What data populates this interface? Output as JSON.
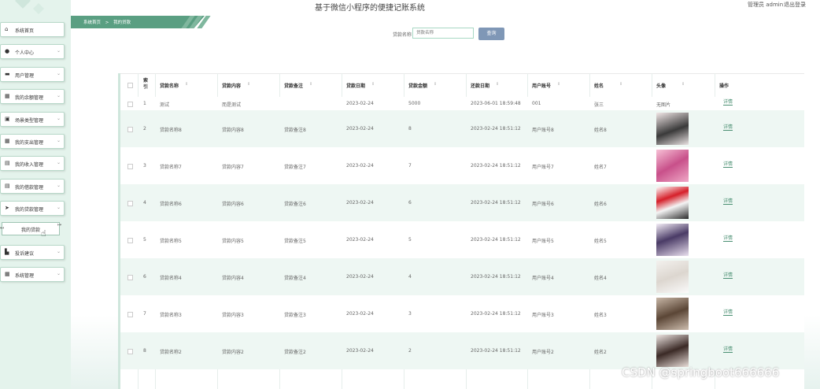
{
  "header": {
    "title": "基于微信小程序的便捷记账系统",
    "user_role": "管理员 admin",
    "logout": "退出登录"
  },
  "breadcrumb": {
    "home": "系统首页",
    "separator": ">",
    "current": "我的贷款"
  },
  "sidebar": {
    "items": [
      {
        "label": "系统首页",
        "icon": "home-icon",
        "glyph": "⌂"
      },
      {
        "label": "个人中心",
        "icon": "person-icon",
        "glyph": "●"
      },
      {
        "label": "用户管理",
        "icon": "users-icon",
        "glyph": "▬"
      },
      {
        "label": "我的余额管理",
        "icon": "grid-icon",
        "glyph": "▦"
      },
      {
        "label": "场景类型管理",
        "icon": "image-icon",
        "glyph": "▣"
      },
      {
        "label": "我的支出管理",
        "icon": "grid-icon",
        "glyph": "▦"
      },
      {
        "label": "我的收入管理",
        "icon": "box-icon",
        "glyph": "▤"
      },
      {
        "label": "我的借款管理",
        "icon": "box-icon",
        "glyph": "▤"
      },
      {
        "label": "我的贷款管理",
        "icon": "send-icon",
        "glyph": "➤"
      },
      {
        "label": "投诉建议",
        "icon": "thumb-icon",
        "glyph": "▙"
      },
      {
        "label": "系统管理",
        "icon": "grid-icon",
        "glyph": "▦"
      }
    ],
    "submenu_label": "我的贷款"
  },
  "search": {
    "label": "贷款名称",
    "placeholder": "贷款名称",
    "button": "查询"
  },
  "table": {
    "columns": [
      "索引",
      "贷款名称",
      "贷款内容",
      "贷款备注",
      "贷款日期",
      "贷款金额",
      "还款日期",
      "用户账号",
      "姓名",
      "头像",
      "操作"
    ],
    "rows": [
      {
        "idx": "1",
        "name": "测试",
        "content": "而是测试",
        "note": "",
        "date": "2023-02-24",
        "amount": "5000",
        "repay": "2023-06-01 18:59:48",
        "account": "001",
        "person": "张三",
        "avatar": "无图片",
        "op": "详情"
      },
      {
        "idx": "2",
        "name": "贷款名称8",
        "content": "贷款内容8",
        "note": "贷款备注8",
        "date": "2023-02-24",
        "amount": "8",
        "repay": "2023-02-24 18:51:12",
        "account": "用户账号8",
        "person": "姓名8",
        "avatar": "",
        "op": "详情"
      },
      {
        "idx": "3",
        "name": "贷款名称7",
        "content": "贷款内容7",
        "note": "贷款备注7",
        "date": "2023-02-24",
        "amount": "7",
        "repay": "2023-02-24 18:51:12",
        "account": "用户账号7",
        "person": "姓名7",
        "avatar": "",
        "op": "详情"
      },
      {
        "idx": "4",
        "name": "贷款名称6",
        "content": "贷款内容6",
        "note": "贷款备注6",
        "date": "2023-02-24",
        "amount": "6",
        "repay": "2023-02-24 18:51:12",
        "account": "用户账号6",
        "person": "姓名6",
        "avatar": "",
        "op": "详情"
      },
      {
        "idx": "5",
        "name": "贷款名称5",
        "content": "贷款内容5",
        "note": "贷款备注5",
        "date": "2023-02-24",
        "amount": "5",
        "repay": "2023-02-24 18:51:12",
        "account": "用户账号5",
        "person": "姓名5",
        "avatar": "",
        "op": "详情"
      },
      {
        "idx": "6",
        "name": "贷款名称4",
        "content": "贷款内容4",
        "note": "贷款备注4",
        "date": "2023-02-24",
        "amount": "4",
        "repay": "2023-02-24 18:51:12",
        "account": "用户账号4",
        "person": "姓名4",
        "avatar": "",
        "op": "详情"
      },
      {
        "idx": "7",
        "name": "贷款名称3",
        "content": "贷款内容3",
        "note": "贷款备注3",
        "date": "2023-02-24",
        "amount": "3",
        "repay": "2023-02-24 18:51:12",
        "account": "用户账号3",
        "person": "姓名3",
        "avatar": "",
        "op": "详情"
      },
      {
        "idx": "8",
        "name": "贷款名称2",
        "content": "贷款内容2",
        "note": "贷款备注2",
        "date": "2023-02-24",
        "amount": "2",
        "repay": "2023-02-24 18:51:12",
        "account": "用户账号2",
        "person": "姓名2",
        "avatar": "",
        "op": "详情"
      }
    ]
  },
  "watermark": "CSDN @springboot666666",
  "colors": {
    "accent": "#5a9f82",
    "sidebar_bg": "#e4f3ec",
    "row_alt": "#eef7f3",
    "button": "#7f97b6"
  }
}
